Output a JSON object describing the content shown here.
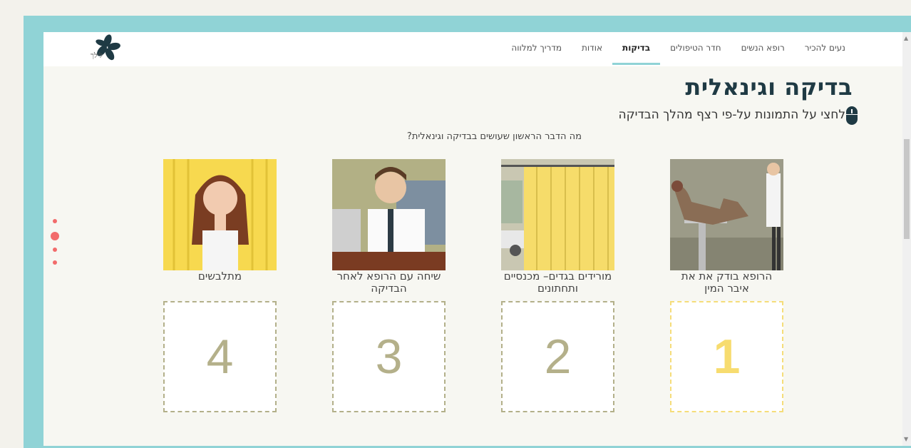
{
  "nav": {
    "items": [
      "נעים להכיר",
      "רופא הנשים",
      "חדר הטיפולים",
      "בדיקות",
      "אודות",
      "מדריך למלווה"
    ],
    "active_index": 3
  },
  "logo": {
    "text": "לילך"
  },
  "page": {
    "title": "בדיקה וגינאלית",
    "instruction": "לחצי על התמונות על-פי רצף מהלך הבדיקה",
    "question": "מה הדבר הראשון שעושים בבדיקה וגינאלית?"
  },
  "cards": [
    {
      "caption": "הרופא בודק את את איבר המין"
    },
    {
      "caption": "מורידים בגדים– מכנסיים ותחתונים"
    },
    {
      "caption": "שיחה עם הרופא לאחר הבדיקה"
    },
    {
      "caption": "מתלבשים"
    }
  ],
  "slots": [
    "1",
    "2",
    "3",
    "4"
  ],
  "colors": {
    "frame": "#90d3d6",
    "accent": "#f7dc6f",
    "dot": "#f26b6b",
    "title": "#1f3a44"
  },
  "icons": [
    "mouse-icon",
    "logo-flower-icon"
  ]
}
